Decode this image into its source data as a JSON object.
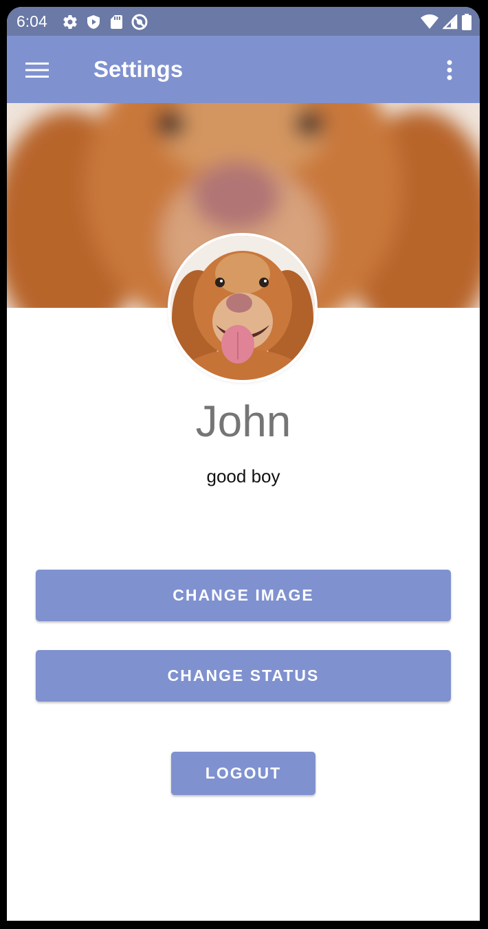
{
  "status_bar": {
    "time": "6:04",
    "left_icons": [
      "settings-gear-icon",
      "play-shield-icon",
      "sd-card-icon",
      "no-disturb-icon"
    ],
    "right_icons": [
      "wifi-icon",
      "signal-icon",
      "battery-icon"
    ]
  },
  "app_bar": {
    "menu_icon": "hamburger-menu-icon",
    "title": "Settings",
    "overflow_icon": "more-vert-icon",
    "color": "#7f91cf"
  },
  "profile": {
    "header_image": "blurred golden dog photo",
    "avatar_image": "golden dog portrait",
    "name": "John",
    "status": "good boy"
  },
  "actions": {
    "change_image": "CHANGE IMAGE",
    "change_status": "CHANGE STATUS",
    "logout": "LOGOUT"
  },
  "colors": {
    "status_bar": "#6a79a6",
    "accent": "#7f91cf",
    "name_text": "#757575"
  }
}
